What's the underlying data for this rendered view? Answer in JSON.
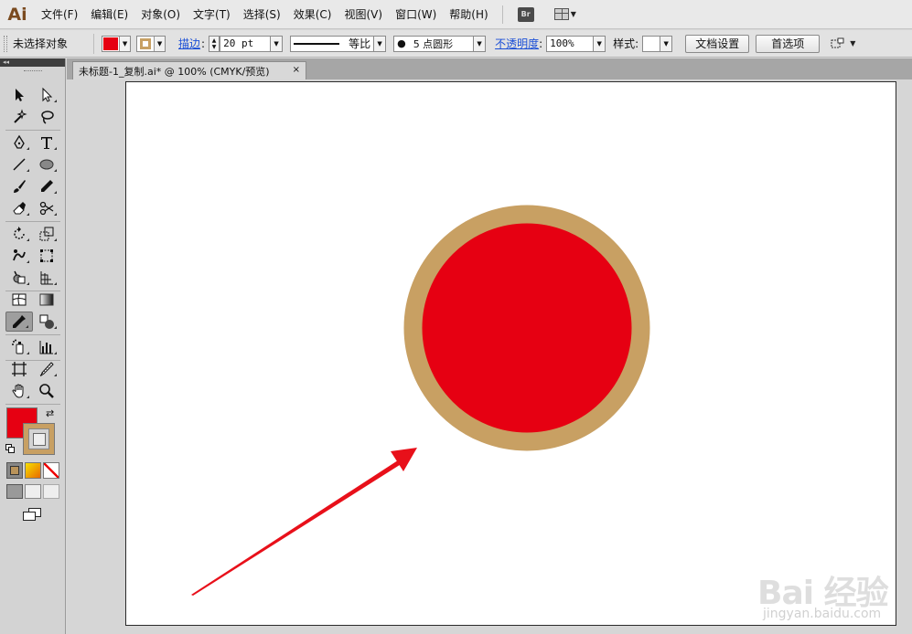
{
  "app": {
    "logo": "Ai",
    "bridge_label": "Br"
  },
  "menu": {
    "items": [
      "文件(F)",
      "编辑(E)",
      "对象(O)",
      "文字(T)",
      "选择(S)",
      "效果(C)",
      "视图(V)",
      "窗口(W)",
      "帮助(H)"
    ]
  },
  "control_bar": {
    "selection_status": "未选择对象",
    "fill_color": "#e60012",
    "stroke_color": "#c8a063",
    "stroke_label": "描边",
    "stroke_weight": "20 pt",
    "stroke_profile_label": "等比",
    "brush_label": "5 点圆形",
    "opacity_label": "不透明度",
    "opacity_value": "100%",
    "style_label": "样式",
    "doc_setup_button": "文档设置",
    "preferences_button": "首选项"
  },
  "document": {
    "tab_title": "未标题-1_复制.ai* @ 100% (CMYK/预览)",
    "close_glyph": "×"
  },
  "artwork": {
    "circle_fill": "#e60012",
    "circle_stroke": "#c8a063",
    "arrow_color": "#e8101a"
  },
  "tools_panel": {
    "collapse_glyph": "◂◂",
    "fill_color": "#e60012",
    "stroke_color": "#c8a063"
  },
  "watermark": {
    "logo_text": "Bai 经验",
    "url": "jingyan.baidu.com"
  }
}
